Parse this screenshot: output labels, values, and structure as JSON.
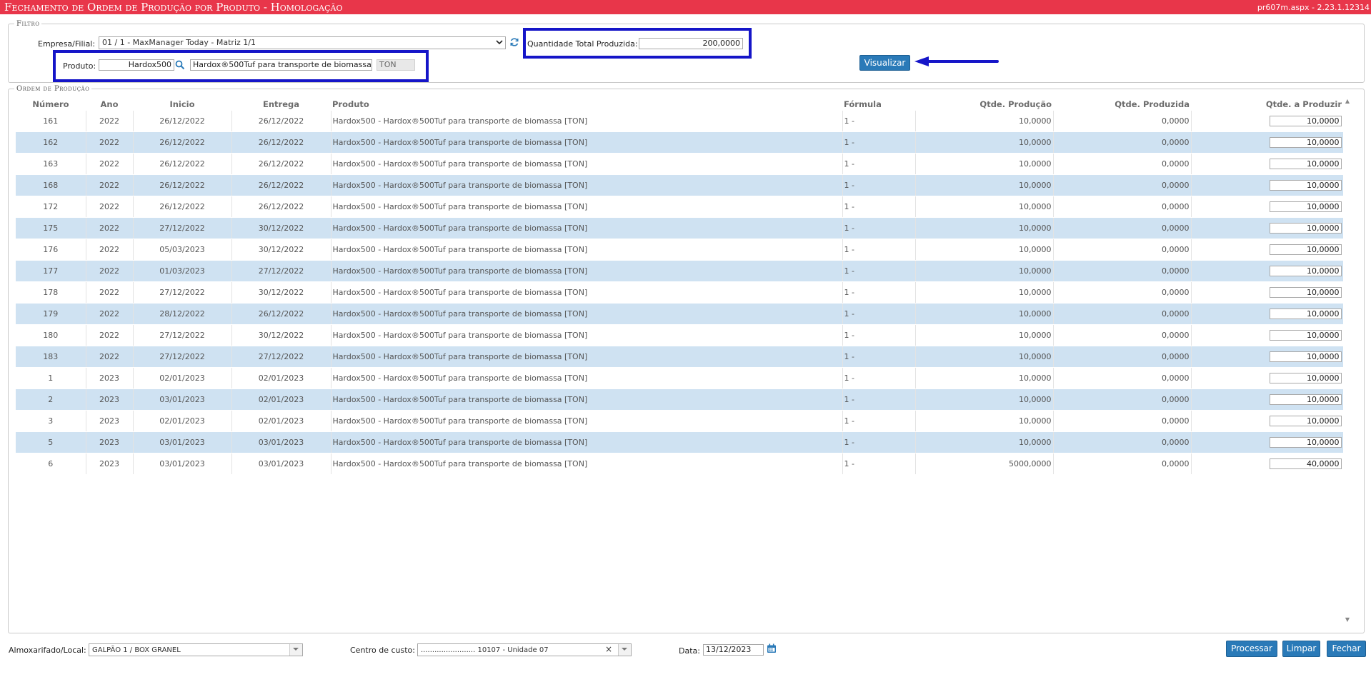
{
  "titlebar": {
    "title": "Fechamento de Ordem de Produção por Produto  - Homologação",
    "version": "pr607m.aspx - 2.23.1.12314"
  },
  "filtro": {
    "legend": "Filtro",
    "empresa_label": "Empresa/Filial:",
    "empresa_value": "01 / 1 - MaxManager Today - Matriz 1/1",
    "produto_label": "Produto:",
    "produto_code": "Hardox500",
    "produto_desc": "Hardox®500Tuf para transporte de biomassa",
    "produto_unit": "TON",
    "qtd_label": "Quantidade Total Produzida:",
    "qtd_value": "200,0000",
    "visualizar_label": "Visualizar"
  },
  "ordem": {
    "legend": "Ordem de Produção",
    "columns": [
      "Número",
      "Ano",
      "Inicio",
      "Entrega",
      "Produto",
      "Fórmula",
      "Qtde. Produção",
      "Qtde. Produzida",
      "Qtde. a Produzir"
    ],
    "rows": [
      {
        "numero": "161",
        "ano": "2022",
        "inicio": "26/12/2022",
        "entrega": "26/12/2022",
        "produto": "Hardox500 - Hardox®500Tuf para transporte de biomassa [TON]",
        "formula": "1 -",
        "qtd_producao": "10,0000",
        "qtd_produzida": "0,0000",
        "qtd_produzir": "10,0000"
      },
      {
        "numero": "162",
        "ano": "2022",
        "inicio": "26/12/2022",
        "entrega": "26/12/2022",
        "produto": "Hardox500 - Hardox®500Tuf para transporte de biomassa [TON]",
        "formula": "1 -",
        "qtd_producao": "10,0000",
        "qtd_produzida": "0,0000",
        "qtd_produzir": "10,0000"
      },
      {
        "numero": "163",
        "ano": "2022",
        "inicio": "26/12/2022",
        "entrega": "26/12/2022",
        "produto": "Hardox500 - Hardox®500Tuf para transporte de biomassa [TON]",
        "formula": "1 -",
        "qtd_producao": "10,0000",
        "qtd_produzida": "0,0000",
        "qtd_produzir": "10,0000"
      },
      {
        "numero": "168",
        "ano": "2022",
        "inicio": "26/12/2022",
        "entrega": "26/12/2022",
        "produto": "Hardox500 - Hardox®500Tuf para transporte de biomassa [TON]",
        "formula": "1 -",
        "qtd_producao": "10,0000",
        "qtd_produzida": "0,0000",
        "qtd_produzir": "10,0000"
      },
      {
        "numero": "172",
        "ano": "2022",
        "inicio": "26/12/2022",
        "entrega": "26/12/2022",
        "produto": "Hardox500 - Hardox®500Tuf para transporte de biomassa [TON]",
        "formula": "1 -",
        "qtd_producao": "10,0000",
        "qtd_produzida": "0,0000",
        "qtd_produzir": "10,0000"
      },
      {
        "numero": "175",
        "ano": "2022",
        "inicio": "27/12/2022",
        "entrega": "30/12/2022",
        "produto": "Hardox500 - Hardox®500Tuf para transporte de biomassa [TON]",
        "formula": "1 -",
        "qtd_producao": "10,0000",
        "qtd_produzida": "0,0000",
        "qtd_produzir": "10,0000"
      },
      {
        "numero": "176",
        "ano": "2022",
        "inicio": "05/03/2023",
        "entrega": "30/12/2022",
        "produto": "Hardox500 - Hardox®500Tuf para transporte de biomassa [TON]",
        "formula": "1 -",
        "qtd_producao": "10,0000",
        "qtd_produzida": "0,0000",
        "qtd_produzir": "10,0000"
      },
      {
        "numero": "177",
        "ano": "2022",
        "inicio": "01/03/2023",
        "entrega": "27/12/2022",
        "produto": "Hardox500 - Hardox®500Tuf para transporte de biomassa [TON]",
        "formula": "1 -",
        "qtd_producao": "10,0000",
        "qtd_produzida": "0,0000",
        "qtd_produzir": "10,0000"
      },
      {
        "numero": "178",
        "ano": "2022",
        "inicio": "27/12/2022",
        "entrega": "30/12/2022",
        "produto": "Hardox500 - Hardox®500Tuf para transporte de biomassa [TON]",
        "formula": "1 -",
        "qtd_producao": "10,0000",
        "qtd_produzida": "0,0000",
        "qtd_produzir": "10,0000"
      },
      {
        "numero": "179",
        "ano": "2022",
        "inicio": "28/12/2022",
        "entrega": "26/12/2022",
        "produto": "Hardox500 - Hardox®500Tuf para transporte de biomassa [TON]",
        "formula": "1 -",
        "qtd_producao": "10,0000",
        "qtd_produzida": "0,0000",
        "qtd_produzir": "10,0000"
      },
      {
        "numero": "180",
        "ano": "2022",
        "inicio": "27/12/2022",
        "entrega": "30/12/2022",
        "produto": "Hardox500 - Hardox®500Tuf para transporte de biomassa [TON]",
        "formula": "1 -",
        "qtd_producao": "10,0000",
        "qtd_produzida": "0,0000",
        "qtd_produzir": "10,0000"
      },
      {
        "numero": "183",
        "ano": "2022",
        "inicio": "27/12/2022",
        "entrega": "27/12/2022",
        "produto": "Hardox500 - Hardox®500Tuf para transporte de biomassa [TON]",
        "formula": "1 -",
        "qtd_producao": "10,0000",
        "qtd_produzida": "0,0000",
        "qtd_produzir": "10,0000"
      },
      {
        "numero": "1",
        "ano": "2023",
        "inicio": "02/01/2023",
        "entrega": "02/01/2023",
        "produto": "Hardox500 - Hardox®500Tuf para transporte de biomassa [TON]",
        "formula": "1 -",
        "qtd_producao": "10,0000",
        "qtd_produzida": "0,0000",
        "qtd_produzir": "10,0000"
      },
      {
        "numero": "2",
        "ano": "2023",
        "inicio": "03/01/2023",
        "entrega": "02/01/2023",
        "produto": "Hardox500 - Hardox®500Tuf para transporte de biomassa [TON]",
        "formula": "1 -",
        "qtd_producao": "10,0000",
        "qtd_produzida": "0,0000",
        "qtd_produzir": "10,0000"
      },
      {
        "numero": "3",
        "ano": "2023",
        "inicio": "02/01/2023",
        "entrega": "02/01/2023",
        "produto": "Hardox500 - Hardox®500Tuf para transporte de biomassa [TON]",
        "formula": "1 -",
        "qtd_producao": "10,0000",
        "qtd_produzida": "0,0000",
        "qtd_produzir": "10,0000"
      },
      {
        "numero": "5",
        "ano": "2023",
        "inicio": "03/01/2023",
        "entrega": "03/01/2023",
        "produto": "Hardox500 - Hardox®500Tuf para transporte de biomassa [TON]",
        "formula": "1 -",
        "qtd_producao": "10,0000",
        "qtd_produzida": "0,0000",
        "qtd_produzir": "10,0000"
      },
      {
        "numero": "6",
        "ano": "2023",
        "inicio": "03/01/2023",
        "entrega": "03/01/2023",
        "produto": "Hardox500 - Hardox®500Tuf para transporte de biomassa [TON]",
        "formula": "1 -",
        "qtd_producao": "5000,0000",
        "qtd_produzida": "0,0000",
        "qtd_produzir": "40,0000"
      }
    ]
  },
  "footer": {
    "almox_label": "Almoxarifado/Local:",
    "almox_value": "GALPÃO 1 / BOX GRANEL",
    "centro_label": "Centro de custo:",
    "centro_value": "........................ 10107 - Unidade 07",
    "centro_clear": "×",
    "data_label": "Data:",
    "data_value": "13/12/2023",
    "processar_label": "Processar",
    "limpar_label": "Limpar",
    "fechar_label": "Fechar"
  },
  "colors": {
    "titlebar": "#e8364a",
    "highlight": "#1515c8",
    "button": "#2a7ab8",
    "row_alt": "#cfe2f2"
  },
  "icons": {
    "refresh": "refresh-icon",
    "search": "search-icon",
    "arrow": "arrow-left-icon",
    "calendar": "calendar-icon",
    "dropdown": "chevron-down-icon"
  }
}
